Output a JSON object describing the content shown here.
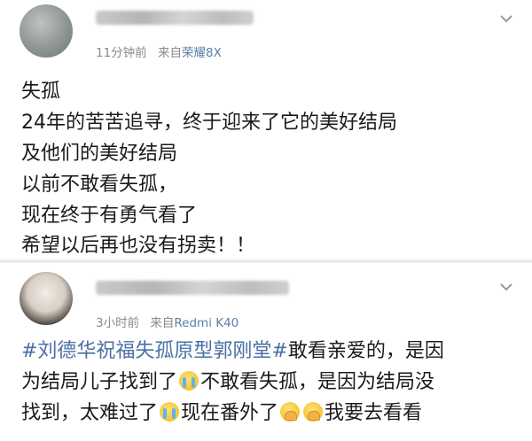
{
  "post1": {
    "time": "11分钟前",
    "source_prefix": "来自",
    "source": "荣耀8X",
    "lines": [
      "失孤",
      "24年的苦苦追寻，终于迎来了它的美好结局",
      "及他们的美好结局",
      "以前不敢看失孤，",
      "现在终于有勇气看了",
      "希望以后再也没有拐卖！！"
    ]
  },
  "post2": {
    "time": "3小时前",
    "source_prefix": "来自",
    "source": "Redmi K40",
    "line1_tag": "#刘德华祝福失孤原型郭刚堂#",
    "line1_text": "敢看亲爱的，是因",
    "line2_a": "为结局儿子找到了",
    "line2_b": "不敢看失孤，是因为结局没",
    "line3_a": "找到，太难过了",
    "line3_b": "现在番外了",
    "line3_c": "我要去看看"
  },
  "icons": {
    "chevron": "chevron-down-icon",
    "cry": "crying-emoji-icon",
    "pray": "praying-emoji-icon"
  },
  "colors": {
    "link": "#4a6fa5",
    "meta": "#8a8a8a",
    "source": "#5b7fa8"
  }
}
